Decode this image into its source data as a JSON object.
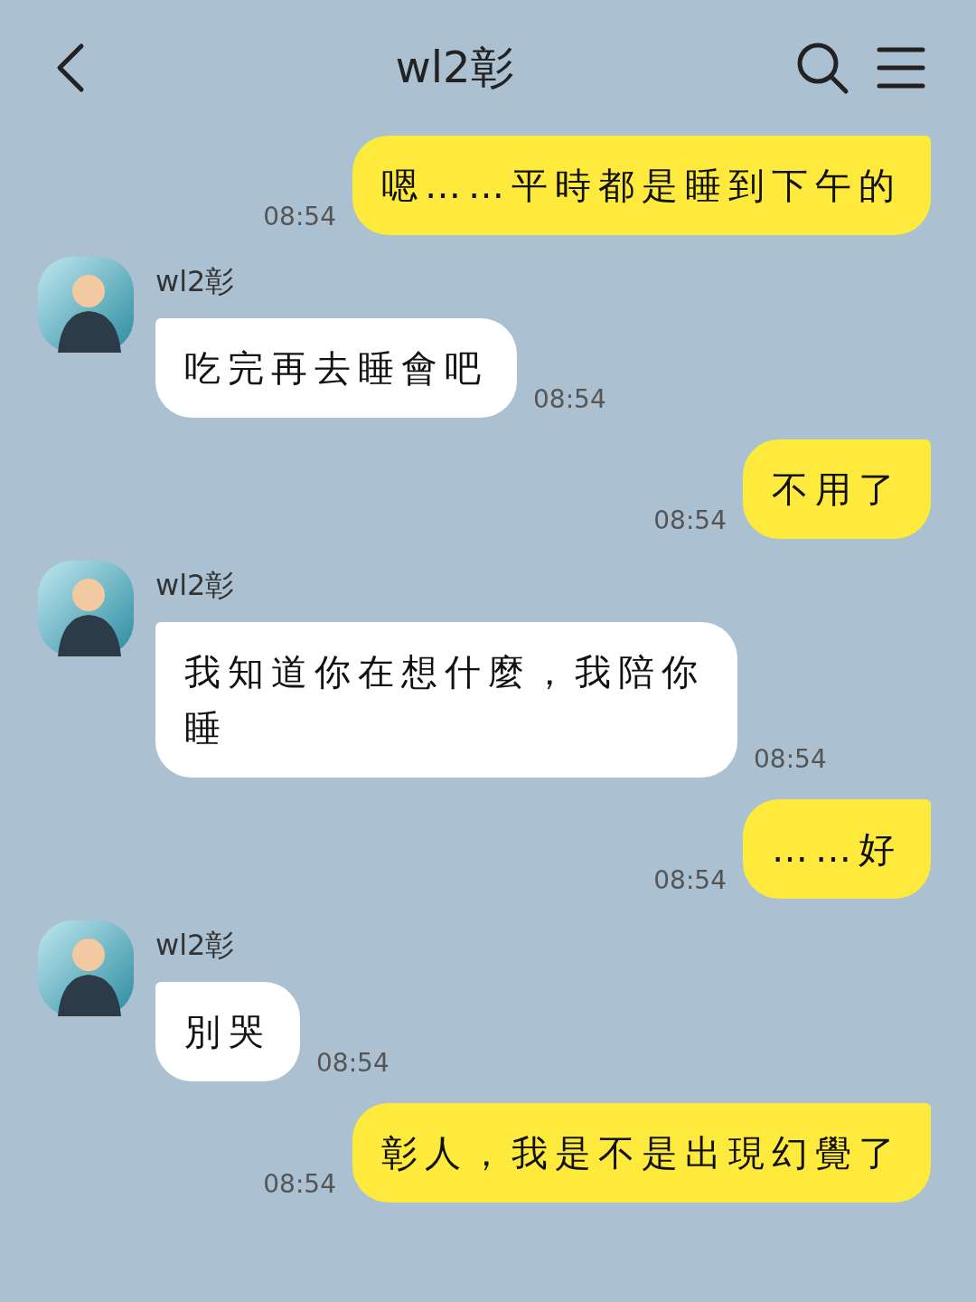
{
  "header": {
    "title": "wl2彰"
  },
  "messages": [
    {
      "kind": "sent",
      "text": "嗯……平時都是睡到下午的",
      "time": "08:54"
    },
    {
      "kind": "received",
      "name": "wl2彰",
      "text": "吃完再去睡會吧",
      "time": "08:54"
    },
    {
      "kind": "sent",
      "text": "不用了",
      "time": "08:54"
    },
    {
      "kind": "received",
      "name": "wl2彰",
      "text": "我知道你在想什麼，我陪你睡",
      "time": "08:54"
    },
    {
      "kind": "sent",
      "text": "……好",
      "time": "08:54"
    },
    {
      "kind": "received",
      "name": "wl2彰",
      "text": "別哭",
      "time": "08:54"
    },
    {
      "kind": "sent",
      "text": "彰人，我是不是出現幻覺了",
      "time": "08:54"
    }
  ]
}
